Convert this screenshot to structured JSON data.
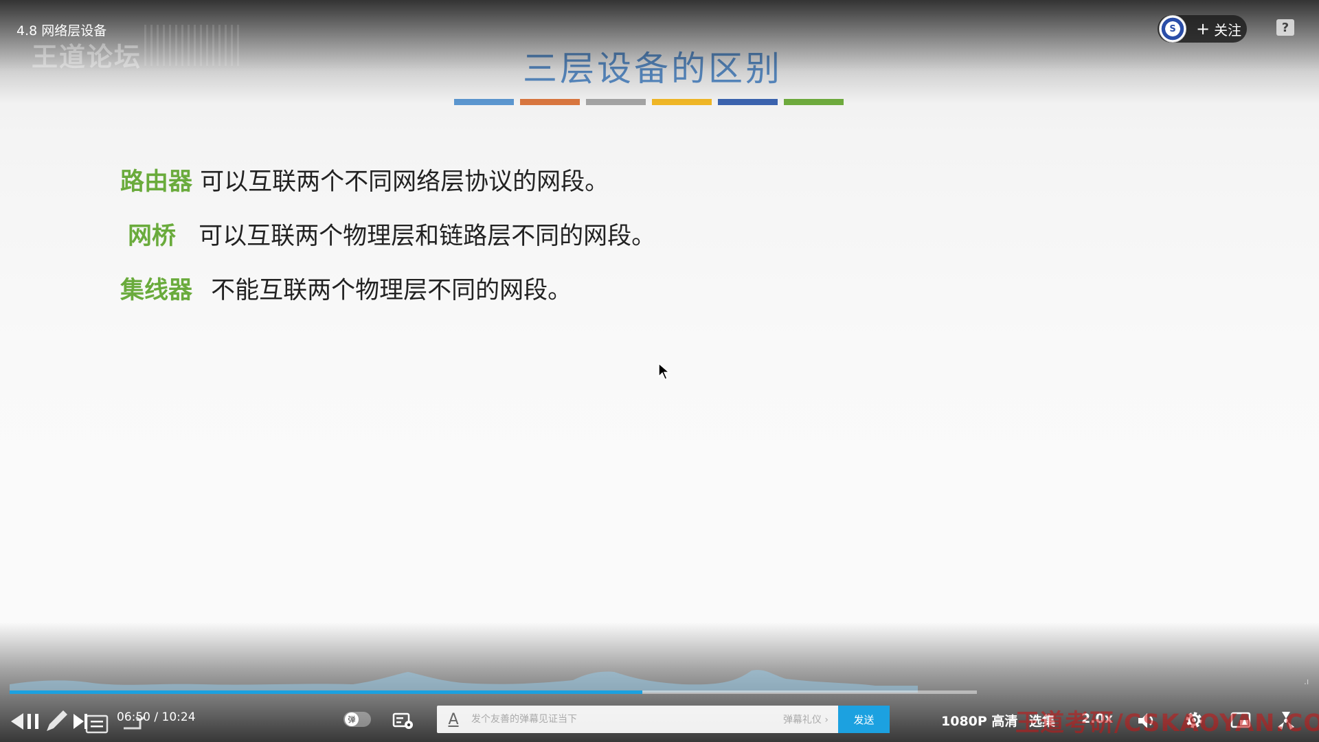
{
  "player": {
    "video_title": "4.8 网络层设备",
    "forum_watermark": "王道论坛",
    "follow_label": "关注",
    "help_label": "?"
  },
  "slide": {
    "title": "三层设备的区别",
    "bar_colors": [
      "#5b96cf",
      "#d8763f",
      "#a3a3a3",
      "#efb626",
      "#3b63ae",
      "#6eaa3d"
    ],
    "lines": [
      {
        "term": "路由器",
        "text": "可以互联两个不同网络层协议的网段。"
      },
      {
        "term": "网桥",
        "text": "可以互联两个物理层和链路层不同的网段。"
      },
      {
        "term": "集线器",
        "text": "不能互联两个物理层不同的网段。"
      }
    ]
  },
  "progress": {
    "played_fraction": 0.654,
    "accent_color": "#1ca1e0"
  },
  "controls": {
    "current_time": "06:50",
    "separator": "/",
    "duration": "10:24",
    "danmaku_toggle_label": "弹",
    "danmaku_placeholder": "发个友善的弹幕见证当下",
    "danmaku_etiquette": "弹幕礼仪 ›",
    "send_label": "发送",
    "quality_label": "1080P 高清",
    "episode_label": "选集",
    "speed_label": "2.0x"
  },
  "watermark": {
    "site_text": "王道考研/CSKAOYAN.COM"
  },
  "icons": {
    "prev": "previous-icon",
    "pause": "pause-icon",
    "pen": "pen-icon",
    "next": "next-icon",
    "playlist": "playlist-icon",
    "danmaku_settings": "danmaku-settings-icon",
    "volume": "volume-icon",
    "settings": "gear-icon",
    "pip": "picture-in-picture-icon",
    "fullscreen": "fullscreen-icon",
    "cursor": "mouse-cursor-icon"
  }
}
